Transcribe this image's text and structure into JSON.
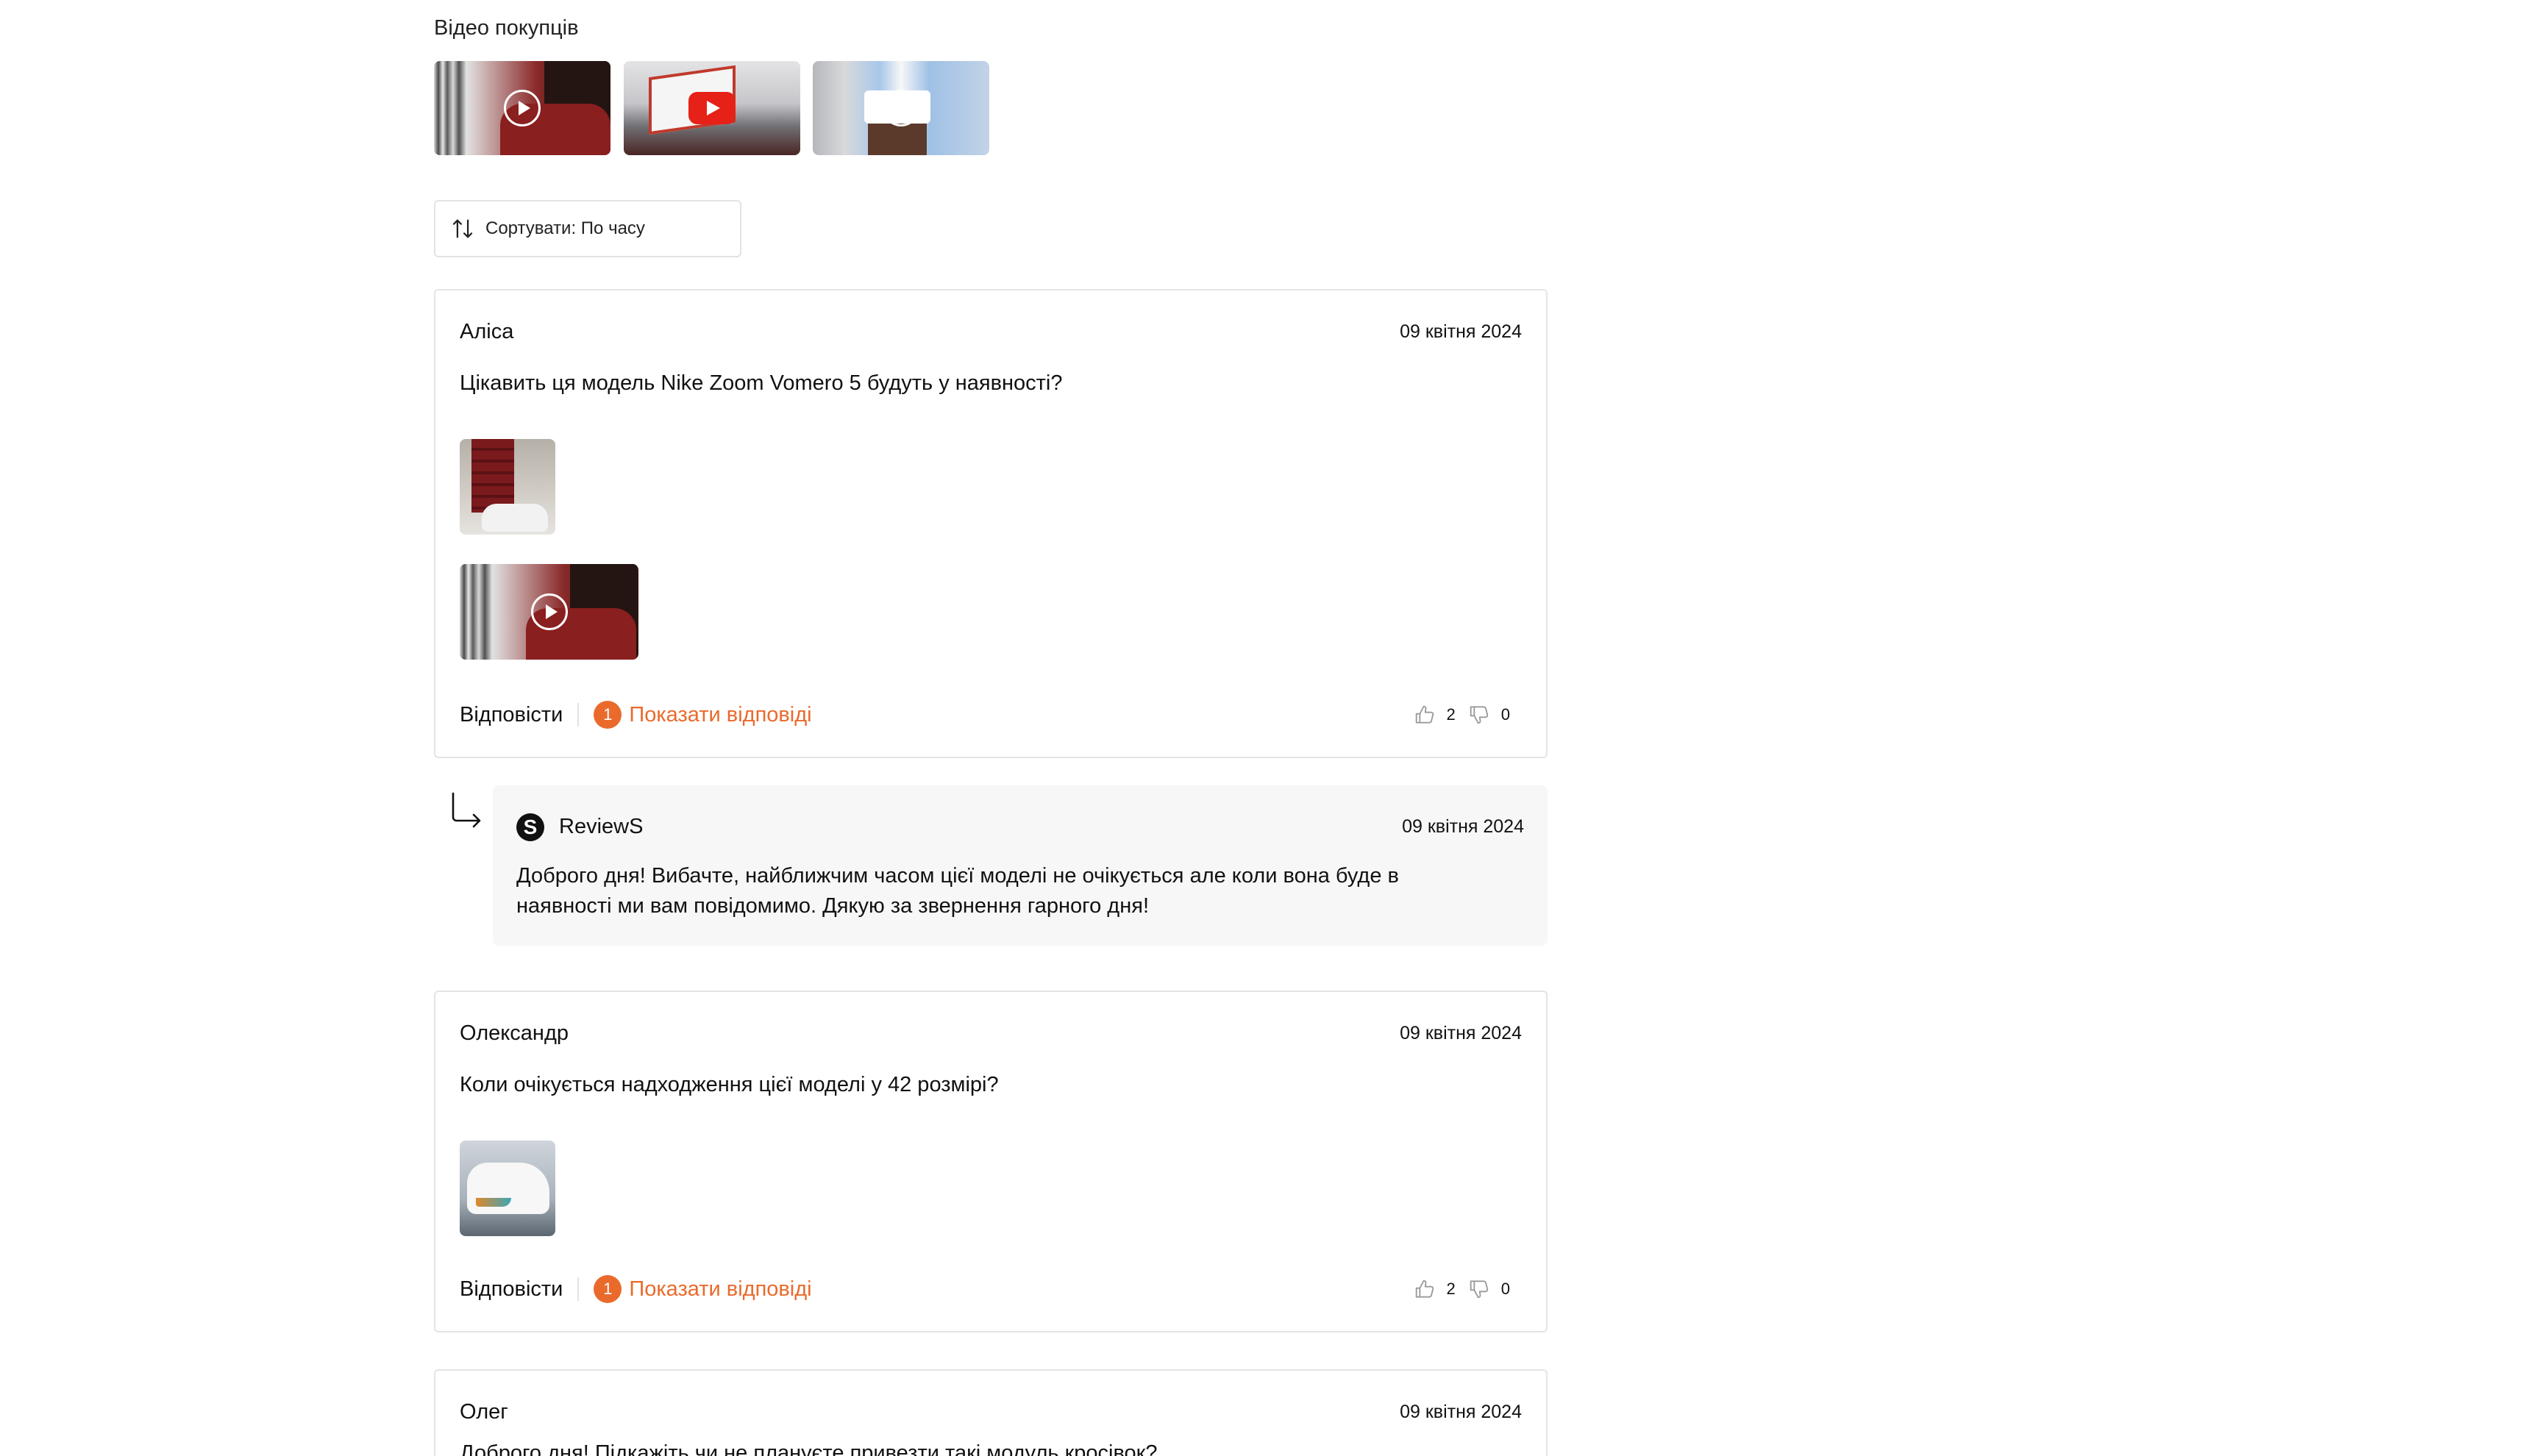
{
  "videos_section": {
    "title": "Відео покупців",
    "items": [
      {
        "icon": "play-circle-icon"
      },
      {
        "icon": "youtube-play-icon"
      },
      {
        "icon": "play-circle-icon"
      }
    ]
  },
  "sort": {
    "icon": "sort-arrows-icon",
    "label": "Сортувати: По часу"
  },
  "reviews": [
    {
      "author": "Аліса",
      "date": "09 квітня 2024",
      "text": "Цікавить ця модель Nike Zoom Vomero 5 будуть у наявності?",
      "actions": {
        "reply_label": "Відповісти",
        "replies_count": "1",
        "show_replies_label": "Показати відповіді",
        "likes": "2",
        "dislikes": "0"
      }
    },
    {
      "author": "Олександр",
      "date": "09 квітня 2024",
      "text": "Коли очікується надходження цієї моделі у 42 розмірі?",
      "actions": {
        "reply_label": "Відповісти",
        "replies_count": "1",
        "show_replies_label": "Показати відповіді",
        "likes": "2",
        "dislikes": "0"
      }
    },
    {
      "author": "Олег",
      "date": "09 квітня 2024",
      "text": "Доброго дня! Підкажіть чи не плануєте привезти такі модуль кросівок?"
    }
  ],
  "reply": {
    "logo_letter": "S",
    "author": "ReviewS",
    "date": "09 квітня 2024",
    "text": "Доброго дня! Вибачте, найближчим часом цієї моделі не очікується але коли вона буде в наявності ми вам повідомимо. Дякую за звернення гарного дня!"
  },
  "colors": {
    "accent": "#ea6a2c",
    "border": "#e4e4e4",
    "reply_background": "#f7f7f7"
  }
}
